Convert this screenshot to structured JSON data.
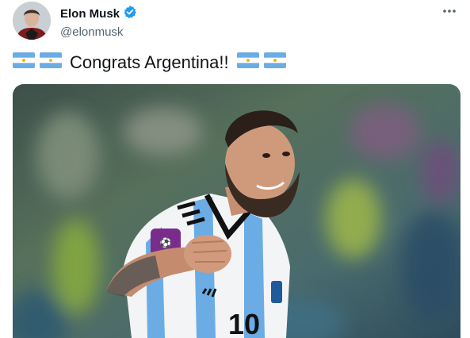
{
  "author": {
    "name": "Elon Musk",
    "handle": "@elonmusk",
    "verified": true,
    "verified_color": "#1d9bf0"
  },
  "tweet": {
    "text": "Congrats Argentina!!",
    "leading_emoji": [
      "flag-argentina-icon",
      "flag-argentina-icon"
    ],
    "trailing_emoji": [
      "flag-argentina-icon",
      "flag-argentina-icon"
    ]
  },
  "media": {
    "jersey_number": "10",
    "colors": {
      "sky_blue": "#6cace4",
      "argentina_sun": "#f6b40e",
      "wc_badge": "#7a2c8c"
    }
  },
  "icons": {
    "more": "more-horizontal-icon",
    "verified": "verified-badge-icon"
  }
}
